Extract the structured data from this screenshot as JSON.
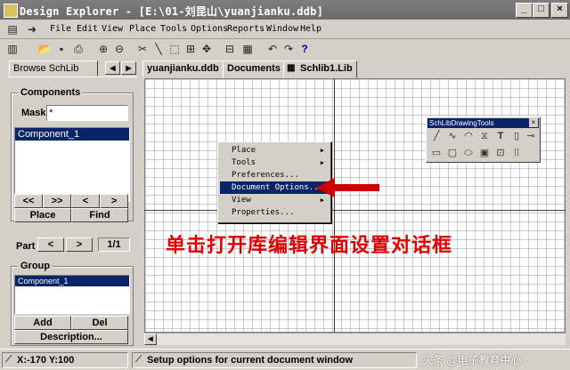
{
  "window": {
    "title": "Design Explorer - [E:\\01-刘昆山\\yuanjianku.ddb]",
    "controls": [
      "_",
      "□",
      "×"
    ]
  },
  "menubar": {
    "items": [
      "File",
      "Edit",
      "View",
      "Place",
      "Tools",
      "Options",
      "Reports",
      "Window",
      "Help"
    ]
  },
  "left_panel": {
    "tab_label": "Browse SchLib",
    "tab_prev": "◀",
    "tab_next": "▶",
    "components_group": "Components",
    "mask_label": "Mask",
    "mask_value": "*",
    "component_list": [
      "Component_1"
    ],
    "nav_first": "<<",
    "nav_prev": "<",
    "nav_next": ">",
    "nav_last": ">>",
    "place_button": "Place",
    "find_button": "Find",
    "part_label": "Part",
    "part_prev": "<",
    "part_next": ">",
    "part_value": "1/1",
    "group_label": "Group",
    "group_list": [
      "Component_1"
    ],
    "add_button": "Add",
    "del_button": "Del",
    "description_button": "Description..."
  },
  "doc_tabs": [
    "yuanjianku.ddb",
    "Documents",
    "Schlib1.Lib"
  ],
  "context_menu": {
    "items": [
      {
        "label": "Place",
        "submenu": true,
        "highlighted": false
      },
      {
        "label": "Tools",
        "submenu": true,
        "highlighted": false
      },
      {
        "label": "Preferences...",
        "submenu": false,
        "highlighted": false
      },
      {
        "label": "Document Options...",
        "submenu": false,
        "highlighted": true
      },
      {
        "label": "View",
        "submenu": true,
        "highlighted": false
      },
      {
        "label": "Properties...",
        "submenu": false,
        "highlighted": false
      }
    ],
    "submenu_arrow": "▶"
  },
  "drawing_tools": {
    "title": "SchLibDrawingTools",
    "close": "×"
  },
  "annotation": {
    "text": "单击打开库编辑界面设置对话框",
    "color": "#e00000"
  },
  "statusbar": {
    "coords": "X:-170 Y:100",
    "message": "Setup options for current document window"
  },
  "watermark": "头条 @电子教育中心",
  "colors": {
    "selection": "#0a246a",
    "arrow": "#cc0000",
    "titlebar": "#6b6b6b"
  }
}
